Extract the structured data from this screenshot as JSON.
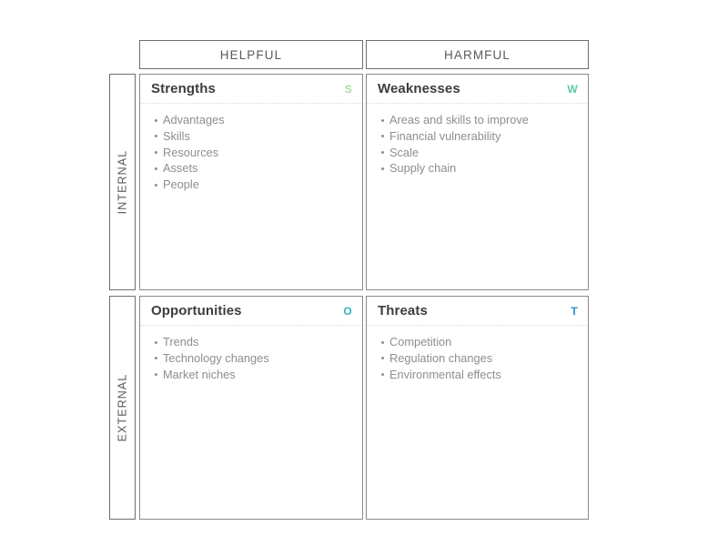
{
  "diagram": {
    "type": "swot-matrix",
    "background_color": "#ffffff"
  },
  "columns": [
    {
      "key": "helpful",
      "label": "HELPFUL"
    },
    {
      "key": "harmful",
      "label": "HARMFUL"
    }
  ],
  "rows": [
    {
      "key": "internal",
      "label": "INTERNAL"
    },
    {
      "key": "external",
      "label": "EXTERNAL"
    }
  ],
  "quadrants": {
    "strengths": {
      "title": "Strengths",
      "badge": "S",
      "badge_color": "#a8dba8",
      "items": [
        "Advantages",
        "Skills",
        "Resources",
        "Assets",
        "People"
      ]
    },
    "weaknesses": {
      "title": "Weaknesses",
      "badge": "W",
      "badge_color": "#5dc8a8",
      "items": [
        "Areas and skills to improve",
        "Financial vulnerability",
        "Scale",
        "Supply chain"
      ]
    },
    "opportunities": {
      "title": "Opportunities",
      "badge": "O",
      "badge_color": "#2fb3bf",
      "items": [
        "Trends",
        "Technology changes",
        "Market niches"
      ]
    },
    "threats": {
      "title": "Threats",
      "badge": "T",
      "badge_color": "#2b8fc7",
      "items": [
        "Competition",
        "Regulation changes",
        "Environmental effects"
      ]
    }
  }
}
